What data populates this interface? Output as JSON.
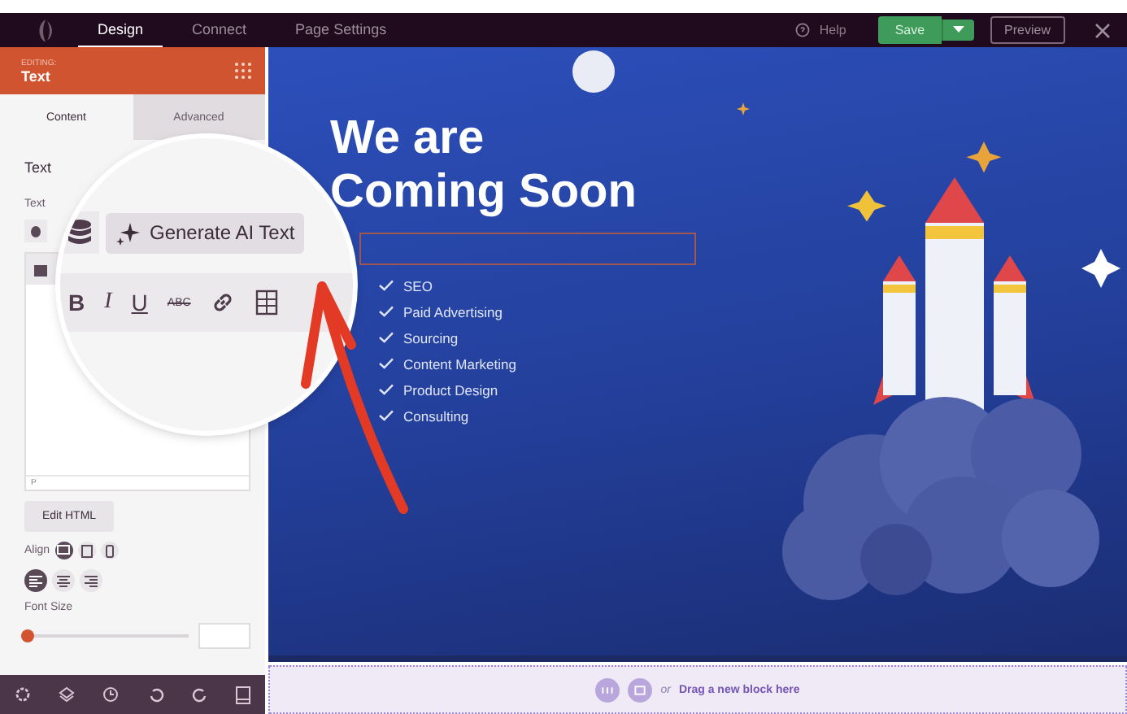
{
  "top_bar": {
    "tabs": [
      {
        "label": "Design",
        "selected": true
      },
      {
        "label": "Connect",
        "selected": false
      },
      {
        "label": "Page Settings",
        "selected": false
      }
    ],
    "help": "Help",
    "save": "Save",
    "preview": "Preview"
  },
  "panel": {
    "editing_label": "EDITING:",
    "module": "Text",
    "tabs": [
      {
        "label": "Content",
        "selected": true
      },
      {
        "label": "Advanced",
        "selected": false
      }
    ],
    "section_title": "Text",
    "field_label": "Text",
    "editor_footer": "P",
    "edit_html": "Edit HTML",
    "align_label": "Align",
    "devices": [
      {
        "kind": "desktop",
        "selected": true
      },
      {
        "kind": "tablet",
        "selected": false
      },
      {
        "kind": "mobile",
        "selected": false
      }
    ],
    "alignments": [
      {
        "kind": "left",
        "selected": true
      },
      {
        "kind": "center",
        "selected": false
      },
      {
        "kind": "right",
        "selected": false
      }
    ],
    "font_size_label": "Font Size",
    "font_size": {
      "level": 0
    }
  },
  "magnifier": {
    "ai_button": "Generate AI Text",
    "format": [
      {
        "kind": "bold",
        "label": "B"
      },
      {
        "kind": "italic",
        "label": "I"
      },
      {
        "kind": "underline",
        "label": "U"
      },
      {
        "kind": "strike",
        "label": "ABC"
      }
    ]
  },
  "canvas": {
    "heading": [
      "We are",
      "Coming Soon"
    ],
    "list": [
      "SEO",
      "Paid Advertising",
      "Sourcing",
      "Content Marketing",
      "Product Design",
      "Consulting"
    ]
  },
  "drop_zone": {
    "or": "or",
    "label": "Drag a new block here"
  }
}
